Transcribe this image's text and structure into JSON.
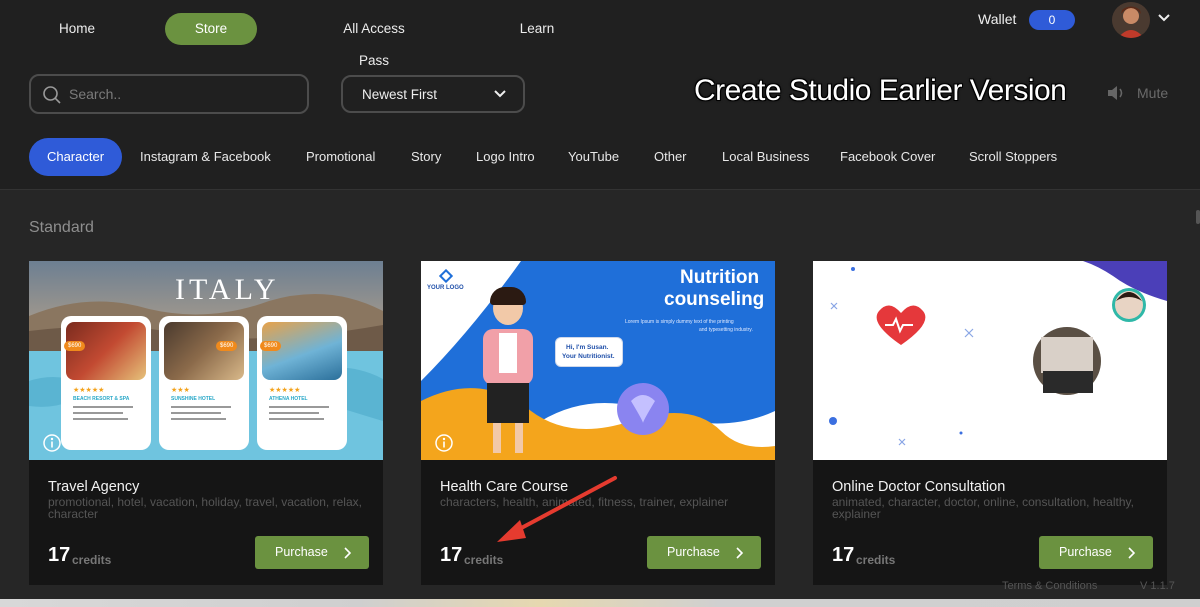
{
  "nav": {
    "items": [
      {
        "label": "Home"
      },
      {
        "label": "Store"
      },
      {
        "label": "All Access Pass"
      },
      {
        "label": "Learn"
      }
    ],
    "wallet_label": "Wallet",
    "wallet_value": "0"
  },
  "toolbar": {
    "search_placeholder": "Search..",
    "sort_value": "Newest First",
    "overlay_title": "Create Studio Earlier Version",
    "mute_label": "Mute"
  },
  "tabs": [
    {
      "label": "Character"
    },
    {
      "label": "Instagram & Facebook"
    },
    {
      "label": "Promotional"
    },
    {
      "label": "Story"
    },
    {
      "label": "Logo Intro"
    },
    {
      "label": "YouTube"
    },
    {
      "label": "Other"
    },
    {
      "label": "Local Business"
    },
    {
      "label": "Facebook Cover"
    },
    {
      "label": "Scroll Stoppers"
    }
  ],
  "section_title": "Standard",
  "cards": [
    {
      "title": "Travel Agency",
      "tags": "promotional, hotel, vacation, holiday, travel, vacation, relax, character",
      "credits": "17",
      "credits_label": "credits",
      "purchase_label": "Purchase",
      "thumb": {
        "headline": "ITALY",
        "price": "$690",
        "rating": "★★★★★",
        "rating_short": "★★★",
        "hotels": [
          "BEACH RESORT & SPA",
          "SUNSHINE HOTEL",
          "ATHENA HOTEL"
        ]
      }
    },
    {
      "title": "Health Care Course",
      "tags": "characters, health, animated, fitness, trainer, explainer",
      "credits": "17",
      "credits_label": "credits",
      "purchase_label": "Purchase",
      "thumb": {
        "logo": "YOUR LOGO",
        "headline_1": "Nutrition",
        "headline_2": "counseling",
        "body_1": "Lorem Ipsum is simply dummy text of the printing",
        "body_2": "and typesetting industry.",
        "bubble_1": "Hi, I'm Susan.",
        "bubble_2": "Your Nutritionist."
      }
    },
    {
      "title": "Online Doctor Consultation",
      "tags": "animated, character, doctor, online, consultation, healthy, explainer",
      "credits": "17",
      "credits_label": "credits",
      "purchase_label": "Purchase"
    }
  ],
  "footer": {
    "terms": "Terms & Conditions",
    "version": "V 1.1.7"
  },
  "colors": {
    "accent_green": "#6b9240",
    "accent_blue": "#2f5bd8",
    "annotation_red": "#e53b2f"
  }
}
